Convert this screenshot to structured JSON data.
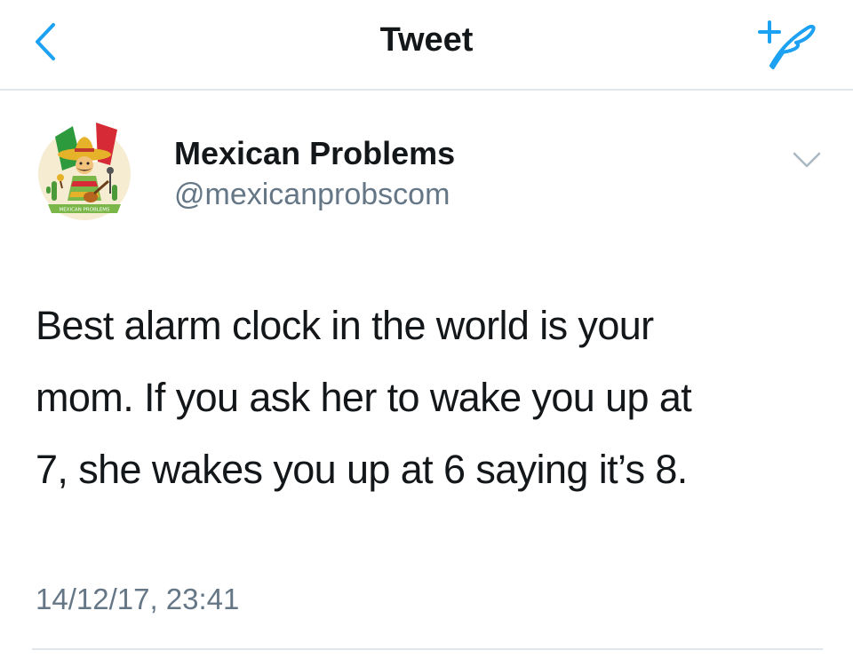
{
  "nav": {
    "title": "Tweet",
    "back_icon": "chevron-left-icon",
    "compose_icon": "compose-tweet-icon",
    "accent_color": "#1da1f2"
  },
  "tweet": {
    "author": {
      "name": "Mexican Problems",
      "handle": "@mexicanprobscom",
      "avatar_text": "MEXICAN PROBLEMS"
    },
    "text_lines": [
      "Best alarm clock in the world is your",
      "mom. If you ask her to wake you up at",
      "7, she wakes you up at 6 saying it’s 8."
    ],
    "timestamp": "14/12/17, 23:41",
    "menu_icon": "chevron-down-icon"
  },
  "colors": {
    "primary_text": "#14171a",
    "secondary_text": "#657786",
    "divider": "#e1e8ed"
  }
}
